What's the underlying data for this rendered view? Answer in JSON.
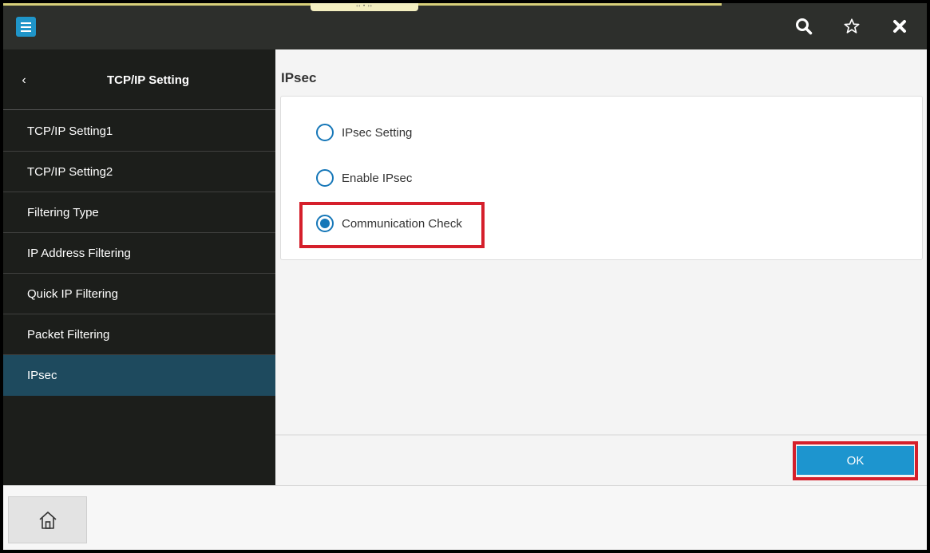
{
  "topbar": {
    "icons": [
      "menu-icon",
      "search-icon",
      "star-icon",
      "close-icon"
    ]
  },
  "sidebar": {
    "title": "TCP/IP Setting",
    "back_glyph": "‹",
    "items": [
      {
        "label": "TCP/IP Setting1",
        "active": false
      },
      {
        "label": "TCP/IP Setting2",
        "active": false
      },
      {
        "label": "Filtering Type",
        "active": false
      },
      {
        "label": "IP Address Filtering",
        "active": false
      },
      {
        "label": "Quick IP Filtering",
        "active": false
      },
      {
        "label": "Packet Filtering",
        "active": false
      },
      {
        "label": "IPsec",
        "active": true
      }
    ]
  },
  "main": {
    "title": "IPsec",
    "options": [
      {
        "label": "IPsec Setting",
        "selected": false
      },
      {
        "label": "Enable IPsec",
        "selected": false
      },
      {
        "label": "Communication Check",
        "selected": true
      }
    ],
    "ok_label": "OK"
  },
  "bottombar": {
    "home_icon": "home-icon"
  },
  "colors": {
    "accent": "#1d95cf",
    "highlight": "#d51f2b",
    "sidebar_bg": "#1c1e1b",
    "sidebar_active": "#1e4a5e",
    "topbar_bg": "#2d2f2c"
  }
}
